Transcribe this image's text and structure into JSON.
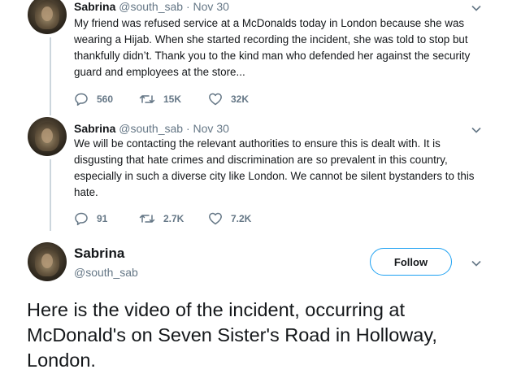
{
  "tweets": [
    {
      "author_name": "Sabrina",
      "handle": "@south_sab",
      "separator": "·",
      "date": "Nov 30",
      "text": "My friend was refused service at a McDonalds today in London because she was wearing a Hijab. When she started recording the incident, she was told to stop but thankfully didn’t. Thank you to the kind man who defended her against the security guard and employees at the store...",
      "replies": "560",
      "retweets": "15K",
      "likes": "32K"
    },
    {
      "author_name": "Sabrina",
      "handle": "@south_sab",
      "separator": "·",
      "date": "Nov 30",
      "text": "We will be contacting the relevant authorities to ensure this is dealt with. It is disgusting that hate crimes and discrimination are so prevalent in this country, especially in such a diverse city like London. We cannot be silent bystanders to this hate.",
      "replies": "91",
      "retweets": "2.7K",
      "likes": "7.2K"
    }
  ],
  "main_tweet": {
    "author_name": "Sabrina",
    "handle": "@south_sab",
    "follow_label": "Follow",
    "text": "Here is the video of the incident, occurring at McDonald's on Seven Sister's Road in Holloway, London."
  },
  "icons": {
    "reply": "reply-icon",
    "retweet": "retweet-icon",
    "like": "heart-icon",
    "more": "chevron-down-icon",
    "avatar": "avatar"
  },
  "colors": {
    "text": "#14171a",
    "secondary": "#657786",
    "accent": "#1da1f2",
    "thread_line": "#ccd6dd"
  }
}
